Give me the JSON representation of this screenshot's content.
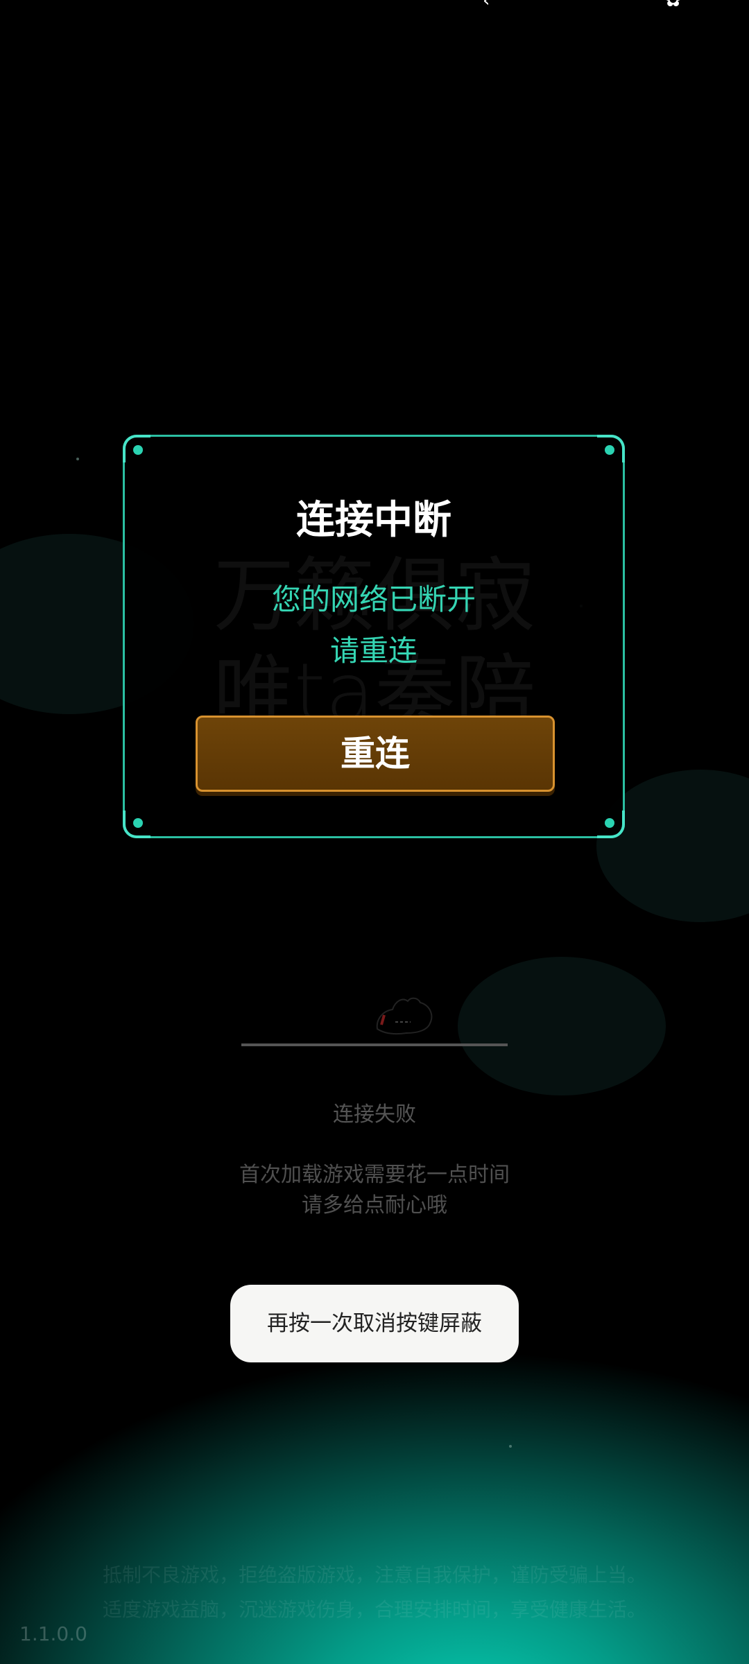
{
  "status_bar": {
    "left_glyph": "‹",
    "right_glyph": "✿"
  },
  "background": {
    "watermark_line1": "万籁俱寂",
    "watermark_line2": "唯ta奏陪",
    "footer_line1": "抵制不良游戏，拒绝盗版游戏，注意自我保护，谨防受骗上当。",
    "footer_line2": "适度游戏益脑，沉迷游戏伤身，合理安排时间，享受健康生活。"
  },
  "dialog": {
    "title": "连接中断",
    "message_line1": "您的网络已断开",
    "message_line2": "请重连",
    "reconnect_label": "重连"
  },
  "loading": {
    "progress": 0,
    "status": "连接失败",
    "hint_line1": "首次加载游戏需要花一点时间",
    "hint_line2": "请多给点耐心哦"
  },
  "toast": {
    "text": "再按一次取消按键屏蔽"
  },
  "version": "1.1.0.0",
  "colors": {
    "accent": "#2bbfa2",
    "message": "#35d6b4",
    "button": "#6e4409",
    "button_border": "#d8922f",
    "glow": "#06c7ad"
  }
}
